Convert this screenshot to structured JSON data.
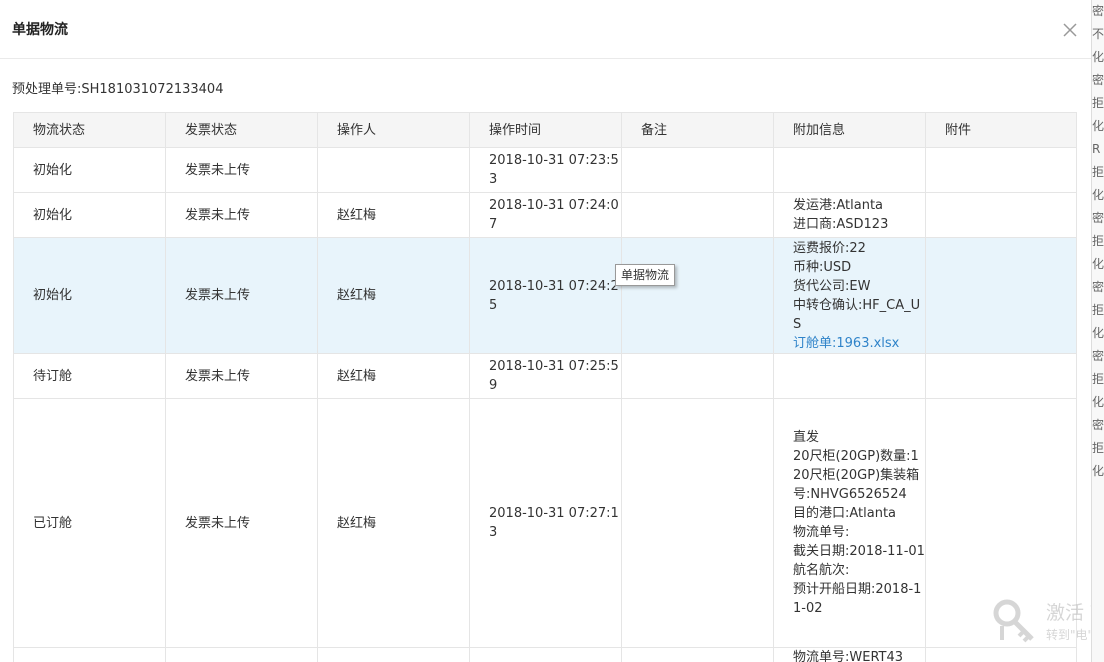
{
  "background": {
    "right_chars": [
      "密",
      "不",
      "化",
      "",
      "密",
      "拒",
      "化",
      "R",
      "拒",
      "化",
      "",
      "",
      "",
      "",
      "密",
      "拒",
      "化",
      "",
      "密",
      "拒",
      "化",
      "",
      "密",
      "拒",
      "化",
      "",
      "密",
      "拒",
      "化"
    ]
  },
  "dialog": {
    "title": "单据物流",
    "order_label": "预处理单号:SH181031072133404",
    "tooltip": "单据物流",
    "columns": [
      "物流状态",
      "发票状态",
      "操作人",
      "操作时间",
      "备注",
      "附加信息",
      "附件"
    ],
    "rows": [
      {
        "status": "初始化",
        "invoice": "发票未上传",
        "operator": "",
        "time": "2018-10-31 07:23:53",
        "note": "",
        "extra": [],
        "attachment": ""
      },
      {
        "status": "初始化",
        "invoice": "发票未上传",
        "operator": "赵红梅",
        "time": "2018-10-31 07:24:07",
        "note": "",
        "extra": [
          "发运港:Atlanta",
          "进口商:ASD123"
        ],
        "attachment": ""
      },
      {
        "status": "初始化",
        "invoice": "发票未上传",
        "operator": "赵红梅",
        "time": "2018-10-31 07:24:25",
        "note": "",
        "extra": [
          "运费报价:22",
          "币种:USD",
          "货代公司:EW",
          "中转仓确认:HF_CA_US"
        ],
        "extra_link": "订舱单:1963.xlsx",
        "attachment": ""
      },
      {
        "status": "待订舱",
        "invoice": "发票未上传",
        "operator": "赵红梅",
        "time": "2018-10-31 07:25:59",
        "note": "",
        "extra": [],
        "attachment": ""
      },
      {
        "status": "已订舱",
        "invoice": "发票未上传",
        "operator": "赵红梅",
        "time": "2018-10-31 07:27:13",
        "note": "",
        "extra": [
          "直发",
          "20尺柜(20GP)数量:1",
          "20尺柜(20GP)集装箱号:NHVG6526524",
          "目的港口:Atlanta",
          "物流单号:",
          "截关日期:2018-11-01",
          "航名航次:",
          "预计开船日期:2018-11-02"
        ],
        "attachment": ""
      },
      {
        "status": "",
        "invoice": "",
        "operator": "",
        "time": "",
        "note": "",
        "extra": [
          "物流单号:WERT43"
        ],
        "attachment": ""
      }
    ]
  },
  "watermark": {
    "line1": "激活 W",
    "line2": "转到\"电\""
  }
}
